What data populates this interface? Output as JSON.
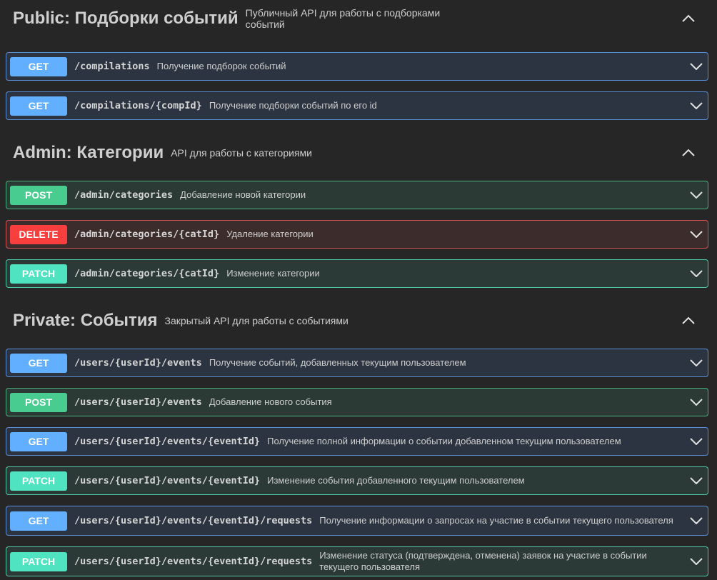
{
  "sections": [
    {
      "title": "Public: Подборки событий",
      "description": "Публичный API для работы с подборками событий",
      "operations": [
        {
          "method": "GET",
          "path": "/compilations",
          "summary": "Получение подборок событий"
        },
        {
          "method": "GET",
          "path": "/compilations/{compId}",
          "summary": "Получение подборки событий по его id"
        }
      ]
    },
    {
      "title": "Admin: Категории",
      "description": "API для работы с категориями",
      "operations": [
        {
          "method": "POST",
          "path": "/admin/categories",
          "summary": "Добавление новой категории"
        },
        {
          "method": "DELETE",
          "path": "/admin/categories/{catId}",
          "summary": "Удаление категории"
        },
        {
          "method": "PATCH",
          "path": "/admin/categories/{catId}",
          "summary": "Изменение категории"
        }
      ]
    },
    {
      "title": "Private: События",
      "description": "Закрытый API для работы с событиями",
      "operations": [
        {
          "method": "GET",
          "path": "/users/{userId}/events",
          "summary": "Получение событий, добавленных текущим пользователем"
        },
        {
          "method": "POST",
          "path": "/users/{userId}/events",
          "summary": "Добавление нового события"
        },
        {
          "method": "GET",
          "path": "/users/{userId}/events/{eventId}",
          "summary": "Получение полной информации о событии добавленном текущим пользователем"
        },
        {
          "method": "PATCH",
          "path": "/users/{userId}/events/{eventId}",
          "summary": "Изменение события добавленного текущим пользователем"
        },
        {
          "method": "GET",
          "path": "/users/{userId}/events/{eventId}/requests",
          "summary": "Получение информации о запросах на участие в событии текущего пользователя"
        },
        {
          "method": "PATCH",
          "path": "/users/{userId}/events/{eventId}/requests",
          "summary": "Изменение статуса (подтверждена, отменена) заявок на участие в событии текущего пользователя"
        }
      ]
    }
  ],
  "icons": {
    "section_toggle": "chevron-up-icon",
    "operation_toggle": "chevron-down-icon"
  },
  "colors": {
    "get": "#61affe",
    "post": "#49cc90",
    "delete": "#f93e3e",
    "patch": "#50e3c2"
  }
}
